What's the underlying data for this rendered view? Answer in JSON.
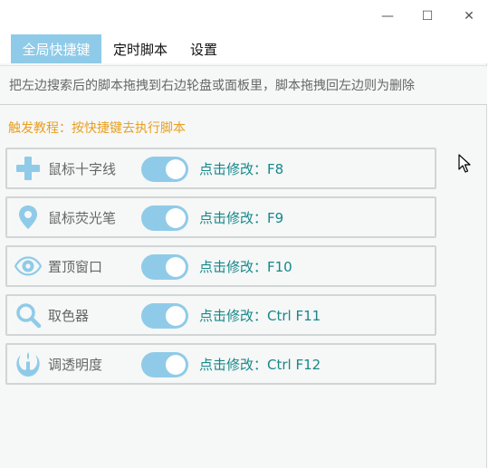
{
  "window": {
    "controls": {
      "minimize": "—",
      "maximize": "☐",
      "close": "✕"
    }
  },
  "tabs": [
    {
      "label": "全局快捷键",
      "active": true
    },
    {
      "label": "定时脚本",
      "active": false
    },
    {
      "label": "设置",
      "active": false
    }
  ],
  "hint": "把左边搜索后的脚本拖拽到右边轮盘或面板里，脚本拖拽回左边则为删除",
  "tutorial": "触发教程：按快捷键去执行脚本",
  "colors": {
    "accent": "#8fcbe8",
    "hotkey_text": "#16888a",
    "tutorial_text": "#e8a020"
  },
  "shortcuts": [
    {
      "icon": "crosshair-plus-icon",
      "label": "鼠标十字线",
      "enabled": true,
      "hotkey_text": "点击修改：F8"
    },
    {
      "icon": "map-pin-icon",
      "label": "鼠标荧光笔",
      "enabled": true,
      "hotkey_text": "点击修改：F9"
    },
    {
      "icon": "eye-icon",
      "label": "置顶窗口",
      "enabled": true,
      "hotkey_text": "点击修改：F10"
    },
    {
      "icon": "magnifier-icon",
      "label": "取色器",
      "enabled": true,
      "hotkey_text": "点击修改：Ctrl F11"
    },
    {
      "icon": "rebel-alliance-icon",
      "label": "调透明度",
      "enabled": true,
      "hotkey_text": "点击修改：Ctrl F12"
    }
  ]
}
